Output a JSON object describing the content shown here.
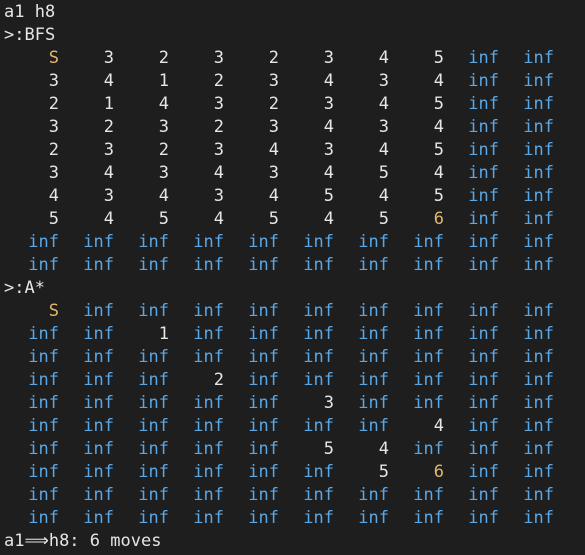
{
  "terminal": {
    "input_line": "a1 h8",
    "bfs_header": ">:BFS",
    "astar_header": ">:A*",
    "result_line": "a1⟹h8: 6 moves"
  },
  "colors": {
    "background": "#1e1e1e",
    "text": "#e6e6e6",
    "inf": "#5aa7e6",
    "highlight": "#e2b86b"
  },
  "bfs_grid": [
    [
      "S",
      "3",
      "2",
      "3",
      "2",
      "3",
      "4",
      "5",
      "inf",
      "inf"
    ],
    [
      "3",
      "4",
      "1",
      "2",
      "3",
      "4",
      "3",
      "4",
      "inf",
      "inf"
    ],
    [
      "2",
      "1",
      "4",
      "3",
      "2",
      "3",
      "4",
      "5",
      "inf",
      "inf"
    ],
    [
      "3",
      "2",
      "3",
      "2",
      "3",
      "4",
      "3",
      "4",
      "inf",
      "inf"
    ],
    [
      "2",
      "3",
      "2",
      "3",
      "4",
      "3",
      "4",
      "5",
      "inf",
      "inf"
    ],
    [
      "3",
      "4",
      "3",
      "4",
      "3",
      "4",
      "5",
      "4",
      "inf",
      "inf"
    ],
    [
      "4",
      "3",
      "4",
      "3",
      "4",
      "5",
      "4",
      "5",
      "inf",
      "inf"
    ],
    [
      "5",
      "4",
      "5",
      "4",
      "5",
      "4",
      "5",
      "6",
      "inf",
      "inf"
    ],
    [
      "inf",
      "inf",
      "inf",
      "inf",
      "inf",
      "inf",
      "inf",
      "inf",
      "inf",
      "inf"
    ],
    [
      "inf",
      "inf",
      "inf",
      "inf",
      "inf",
      "inf",
      "inf",
      "inf",
      "inf",
      "inf"
    ]
  ],
  "astar_grid": [
    [
      "S",
      "inf",
      "inf",
      "inf",
      "inf",
      "inf",
      "inf",
      "inf",
      "inf",
      "inf"
    ],
    [
      "inf",
      "inf",
      "1",
      "inf",
      "inf",
      "inf",
      "inf",
      "inf",
      "inf",
      "inf"
    ],
    [
      "inf",
      "inf",
      "inf",
      "inf",
      "inf",
      "inf",
      "inf",
      "inf",
      "inf",
      "inf"
    ],
    [
      "inf",
      "inf",
      "inf",
      "2",
      "inf",
      "inf",
      "inf",
      "inf",
      "inf",
      "inf"
    ],
    [
      "inf",
      "inf",
      "inf",
      "inf",
      "inf",
      "3",
      "inf",
      "inf",
      "inf",
      "inf"
    ],
    [
      "inf",
      "inf",
      "inf",
      "inf",
      "inf",
      "inf",
      "inf",
      "4",
      "inf",
      "inf"
    ],
    [
      "inf",
      "inf",
      "inf",
      "inf",
      "inf",
      "5",
      "4",
      "inf",
      "inf",
      "inf"
    ],
    [
      "inf",
      "inf",
      "inf",
      "inf",
      "inf",
      "inf",
      "5",
      "6",
      "inf",
      "inf"
    ],
    [
      "inf",
      "inf",
      "inf",
      "inf",
      "inf",
      "inf",
      "inf",
      "inf",
      "inf",
      "inf"
    ],
    [
      "inf",
      "inf",
      "inf",
      "inf",
      "inf",
      "inf",
      "inf",
      "inf",
      "inf",
      "inf"
    ]
  ],
  "highlight_cells": {
    "bfs": [
      [
        0,
        0
      ],
      [
        7,
        7
      ]
    ],
    "astar": [
      [
        0,
        0
      ],
      [
        7,
        7
      ]
    ]
  }
}
